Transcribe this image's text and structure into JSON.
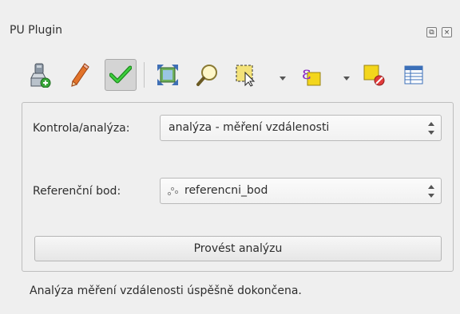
{
  "window": {
    "title": "PU Plugin",
    "float_label": "⧉",
    "close_label": "×"
  },
  "toolbar": {
    "icons": [
      "import-layer-icon",
      "pencil-icon",
      "check-icon",
      "zoom-full-icon",
      "zoom-search-icon",
      "select-feature-icon",
      "expression-icon",
      "select-all-icon",
      "deselect-icon",
      "attribute-table-icon"
    ],
    "active": "check-icon",
    "colors": {
      "check": "#2fb52f",
      "active_bg": "#d4d4d4",
      "select": "#f3d61c",
      "deselect_red": "#e23b3b"
    }
  },
  "form": {
    "check_label": "Kontrola/analýza:",
    "check_value": "analýza - měření vzdálenosti",
    "ref_label": "Referenční bod:",
    "ref_value": "referencni_bod",
    "run_button": "Provést analýzu"
  },
  "status": {
    "message": "Analýza měření vzdálenosti úspěšně dokončena."
  }
}
